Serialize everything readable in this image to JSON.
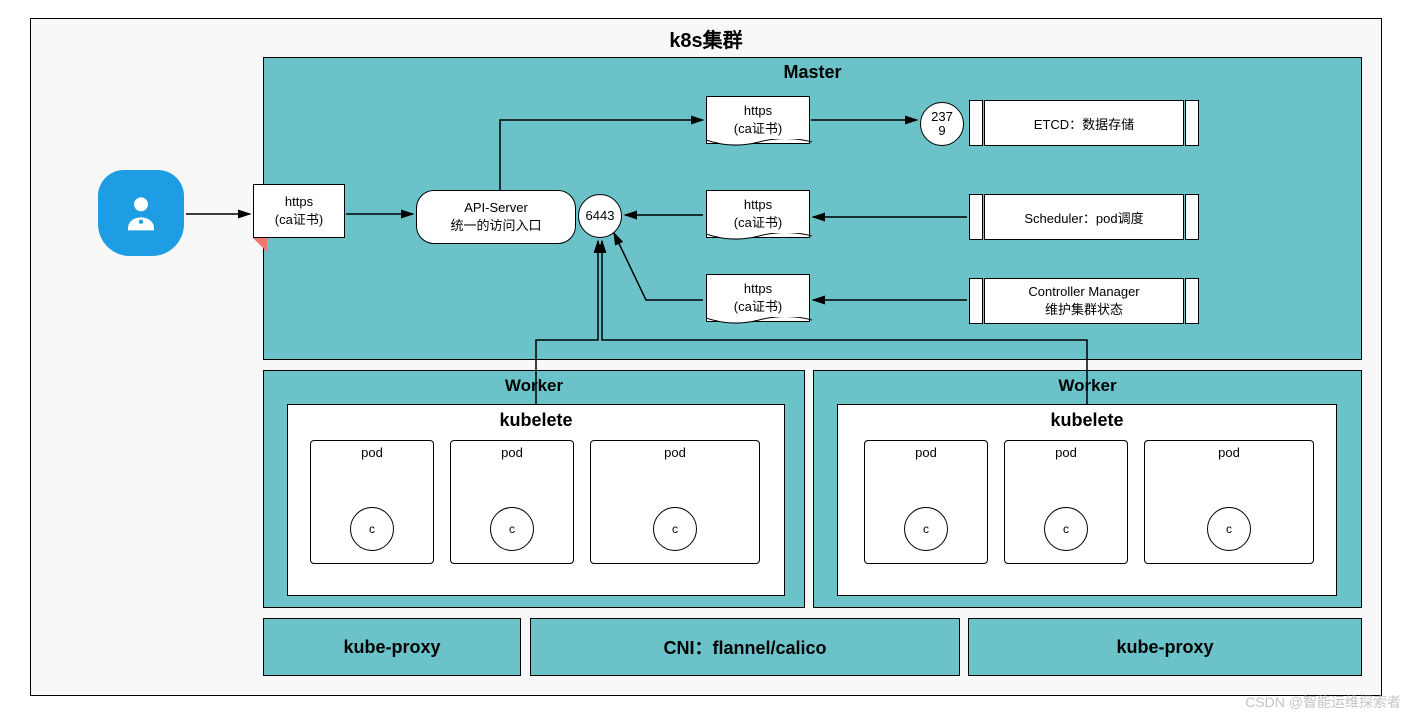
{
  "cluster_title": "k8s集群",
  "master_title": "Master",
  "user_https_label1": "https",
  "user_https_label2": "(ca证书)",
  "api_server_line1": "API-Server",
  "api_server_line2": "统一的访问入口",
  "api_port": "6443",
  "etcd_port": "237\n9",
  "https_note_line1": "https",
  "https_note_line2": "(ca证书)",
  "etcd_label": "ETCD：数据存储",
  "scheduler_label": "Scheduler：pod调度",
  "controller_line1": "Controller Manager",
  "controller_line2": "维护集群状态",
  "worker_title": "Worker",
  "kubelet_title": "kubelete",
  "pod_label": "pod",
  "pod_c": "c",
  "kube_proxy": "kube-proxy",
  "cni_label": "CNI：flannel/calico",
  "watermark": "CSDN @智能运维探索者"
}
